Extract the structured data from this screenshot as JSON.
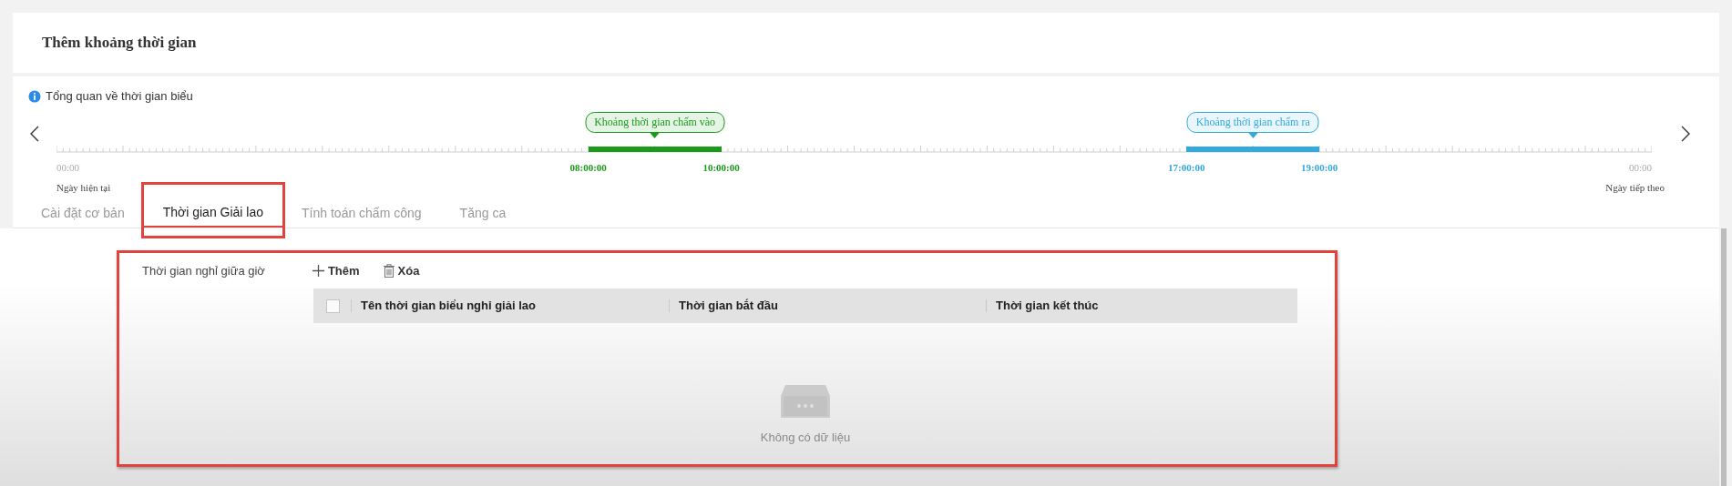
{
  "header": {
    "title": "Thêm khoảng thời gian"
  },
  "overview": {
    "title": "Tổng quan về thời gian biểu",
    "start_label": "00:00",
    "start_caption": "Ngày hiện tại",
    "end_label": "00:00",
    "end_caption": "Ngày tiếp theo",
    "ranges": [
      {
        "label": "Khoảng thời gian chấm vào",
        "start": "08:00:00",
        "end": "10:00:00",
        "color": "#1a9a1a"
      },
      {
        "label": "Khoảng thời gian chấm ra",
        "start": "17:00:00",
        "end": "19:00:00",
        "color": "#33a9dc"
      }
    ]
  },
  "tabs": [
    {
      "label": "Cài đặt cơ bản",
      "selected": false,
      "highlighted": false
    },
    {
      "label": "Thời gian Giải lao",
      "selected": true,
      "highlighted": true
    },
    {
      "label": "Tính toán chấm công",
      "selected": false,
      "highlighted": false
    },
    {
      "label": "Tăng ca",
      "selected": false,
      "highlighted": false
    }
  ],
  "break_section": {
    "highlighted": true,
    "label": "Thời gian nghỉ giữa giờ",
    "add_button": "Thêm",
    "delete_button": "Xóa",
    "table": {
      "select_all_checked": false,
      "columns": [
        "Tên thời gian biểu nghỉ giải lao",
        "Thời gian bắt đầu",
        "Thời gian kết thúc"
      ],
      "empty_text": "Không có dữ liệu"
    }
  }
}
